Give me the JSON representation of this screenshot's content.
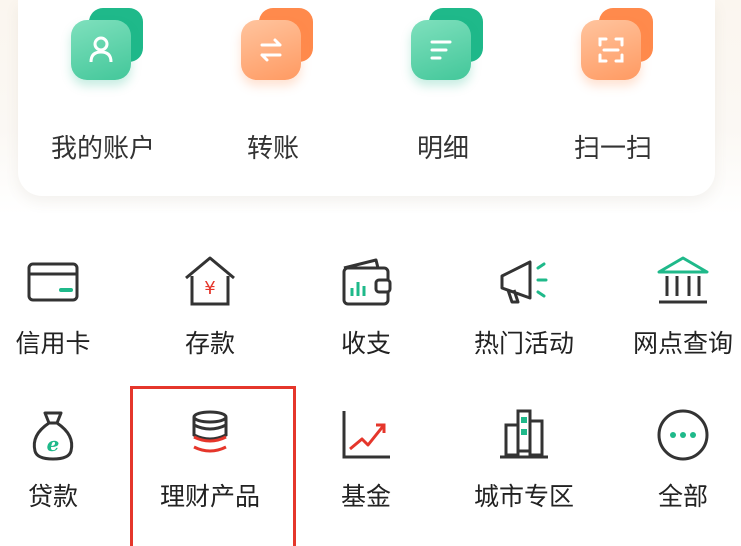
{
  "quick_actions": [
    {
      "label": "我的账户",
      "icon": "person-icon"
    },
    {
      "label": "转账",
      "icon": "transfer-arrows-icon"
    },
    {
      "label": "明细",
      "icon": "document-lines-icon"
    },
    {
      "label": "扫一扫",
      "icon": "scan-icon"
    }
  ],
  "services_row1": [
    {
      "label": "信用卡",
      "icon": "credit-card-icon"
    },
    {
      "label": "存款",
      "icon": "deposit-house-icon"
    },
    {
      "label": "收支",
      "icon": "wallet-chart-icon"
    },
    {
      "label": "热门活动",
      "icon": "megaphone-icon"
    },
    {
      "label": "网点查询",
      "icon": "bank-building-icon"
    }
  ],
  "services_row2": [
    {
      "label": "贷款",
      "icon": "money-bag-icon"
    },
    {
      "label": "理财产品",
      "icon": "coin-stack-icon"
    },
    {
      "label": "基金",
      "icon": "trend-chart-icon"
    },
    {
      "label": "城市专区",
      "icon": "city-building-icon"
    },
    {
      "label": "全部",
      "icon": "more-dots-icon"
    }
  ],
  "colors": {
    "green": "#1fb98a",
    "orange": "#ff8a4c",
    "highlight_border": "#e5362b"
  }
}
